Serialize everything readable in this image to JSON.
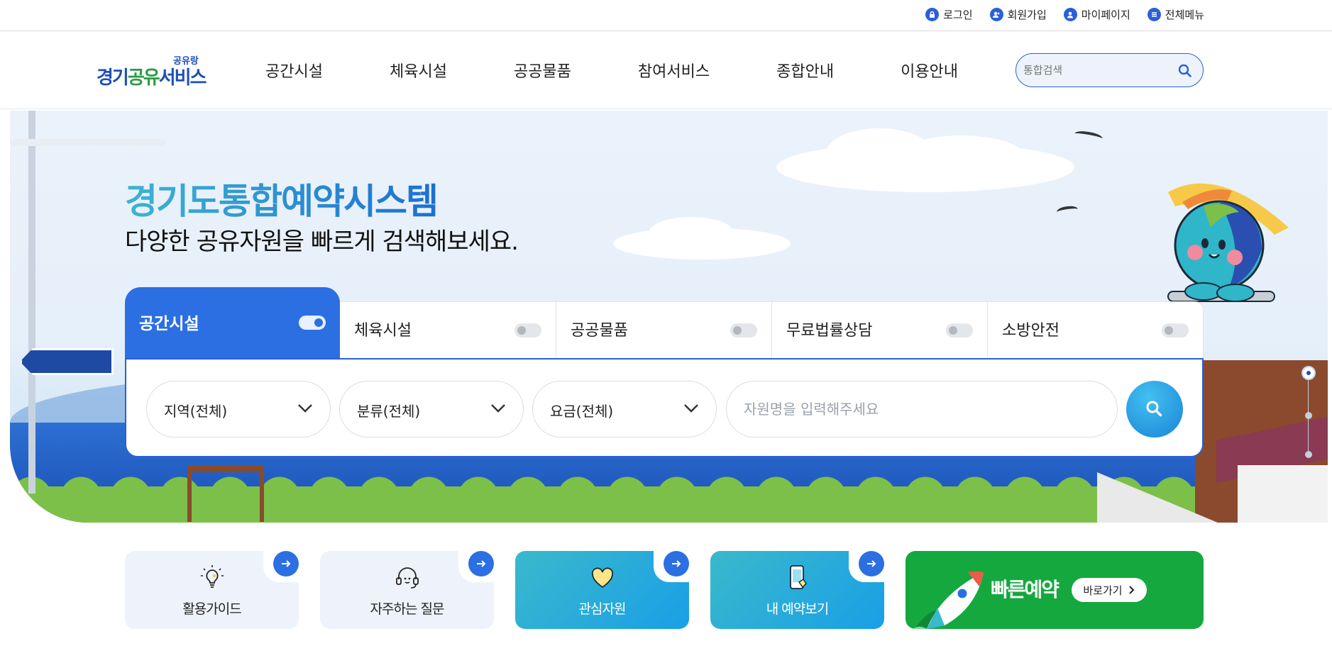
{
  "util_nav": {
    "login": "로그인",
    "signup": "회원가입",
    "mypage": "마이페이지",
    "all_menu": "전체메뉴"
  },
  "logo": {
    "sub": "공유랑",
    "main_1": "경기",
    "main_2": "공유",
    "main_3": "서비스"
  },
  "gnb": [
    "공간시설",
    "체육시설",
    "공공물품",
    "참여서비스",
    "종합안내",
    "이용안내"
  ],
  "header_search": {
    "placeholder": "통합검색"
  },
  "hero": {
    "title": "경기도통합예약시스템",
    "subtitle": "다양한 공유자원을 빠르게 검색해보세요."
  },
  "tabs": [
    {
      "label": "공간시설",
      "active": true
    },
    {
      "label": "체육시설",
      "active": false
    },
    {
      "label": "공공물품",
      "active": false
    },
    {
      "label": "무료법률상담",
      "active": false
    },
    {
      "label": "소방안전",
      "active": false
    }
  ],
  "filters": {
    "region": "지역(전체)",
    "category": "분류(전체)",
    "fee": "요금(전체)",
    "keyword_placeholder": "자원명을 입력해주세요"
  },
  "quick_links": {
    "guide": "활용가이드",
    "faq": "자주하는 질문",
    "favorites": "관심자원",
    "my_reservations": "내 예약보기",
    "fast_reservation": "빠른예약",
    "go": "바로가기"
  },
  "colors": {
    "primary": "#2b6fe2",
    "brand_blue": "#1d4fb6",
    "brand_green": "#2a9d43",
    "quick_green": "#14a83f",
    "quick_teal": "#1a9fe6"
  },
  "icons": {
    "login": "lock-icon",
    "signup": "user-add-icon",
    "mypage": "user-icon",
    "all_menu": "menu-icon",
    "search": "search-icon",
    "chevron": "chevron-down-icon",
    "arrow": "arrow-right-icon",
    "guide": "lightbulb-icon",
    "faq": "headset-icon",
    "favorites": "heart-icon",
    "my_reservations": "phone-touch-icon",
    "fast_reservation": "rocket-icon"
  }
}
